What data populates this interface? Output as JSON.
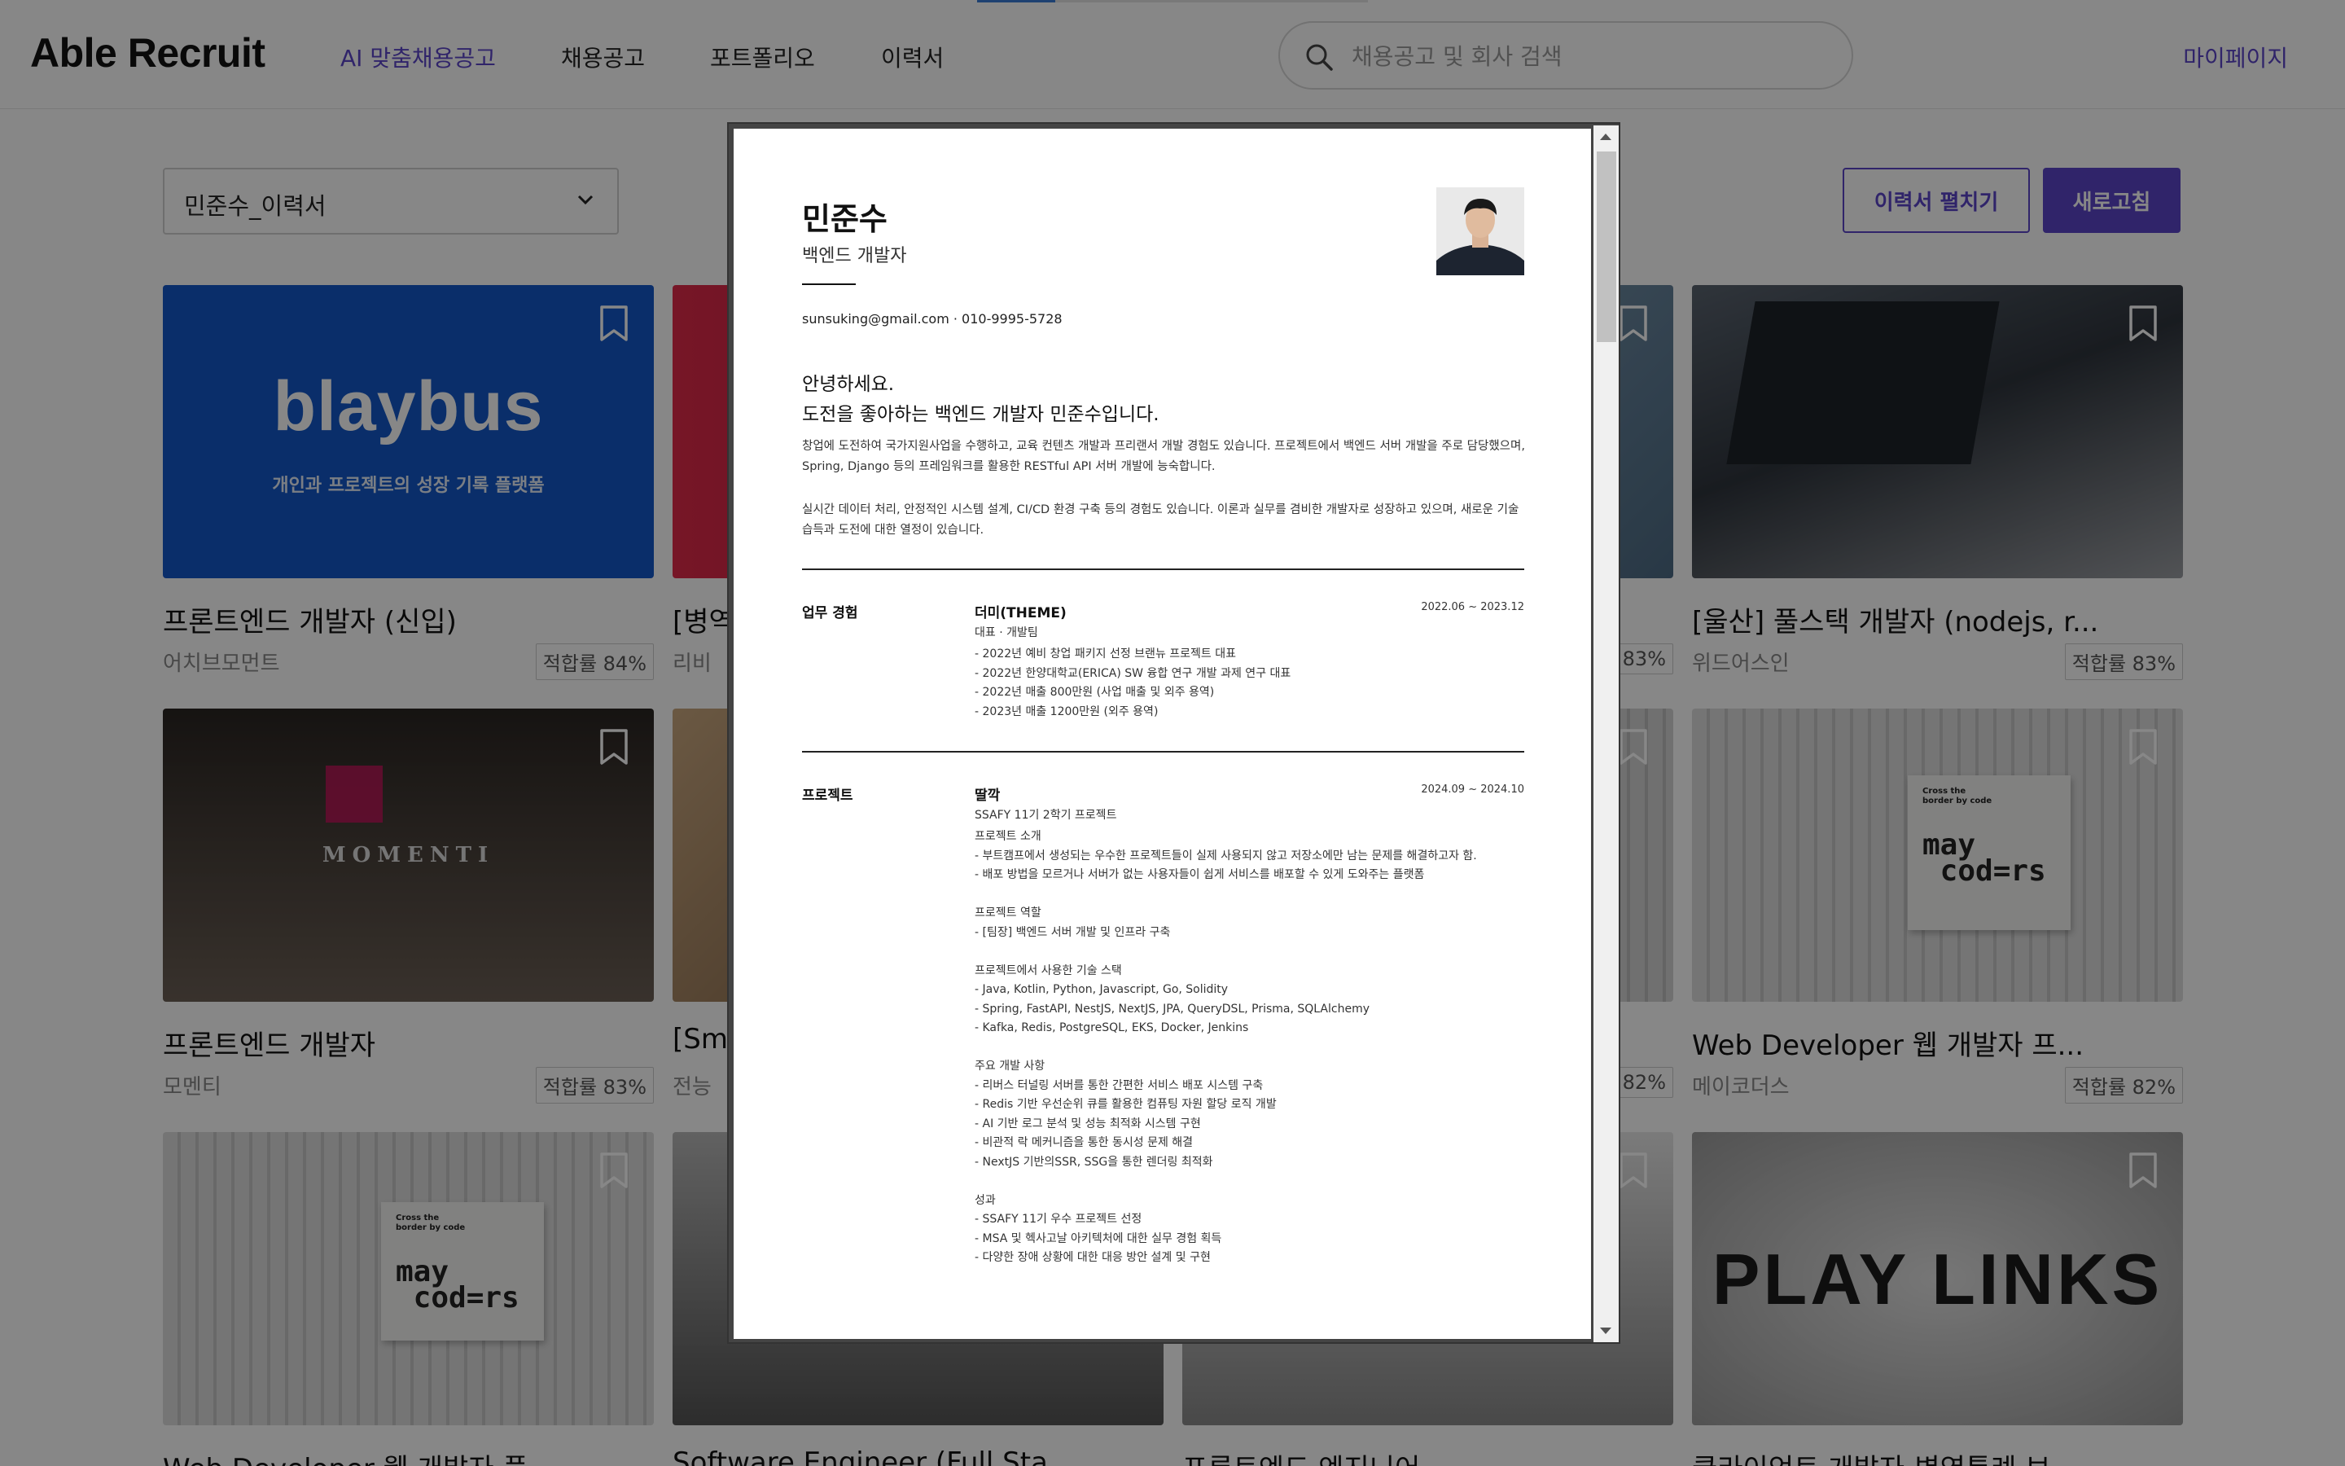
{
  "app": {
    "logo": "Able Recruit"
  },
  "nav": {
    "items": [
      "AI 맞춤채용공고",
      "채용공고",
      "포트폴리오",
      "이력서"
    ],
    "mypage": "마이페이지"
  },
  "search": {
    "placeholder": "채용공고 및 회사 검색"
  },
  "loading_progress": 0.2,
  "toolbar": {
    "resume_select": "민준수_이력서",
    "expand_button": "이력서 펼치기",
    "refresh_button": "새로고침"
  },
  "jobs": [
    {
      "title": "프론트엔드 개발자 (신입)",
      "company": "어치브모먼트",
      "match": "적합률 84%",
      "thumb_text": "blaybus",
      "thumb_sub": "개인과 프로젝트의 성장 기록 플랫폼"
    },
    {
      "title": "[병역",
      "company": "리비",
      "match": "",
      "thumb_text": "",
      "thumb_sub": ""
    },
    {
      "title": "",
      "company": "",
      "match": "83%",
      "thumb_text": "",
      "thumb_sub": ""
    },
    {
      "title": "[울산] 풀스택 개발자 (nodejs, r...",
      "company": "위드어스인",
      "match": "적합률 83%",
      "thumb_text": "",
      "thumb_sub": ""
    },
    {
      "title": "프론트엔드 개발자",
      "company": "모멘티",
      "match": "적합률 83%",
      "thumb_text": "MOMENTI",
      "thumb_sub": ""
    },
    {
      "title": "[Sm",
      "company": "전능",
      "match": "",
      "thumb_text": "",
      "thumb_sub": ""
    },
    {
      "title": "",
      "company": "",
      "match": "82%",
      "thumb_text": "",
      "thumb_sub": ""
    },
    {
      "title": "Web Developer 웹 개발자 프...",
      "company": "메이코더스",
      "match": "적합률 82%",
      "thumb_text": "Cross the border by code maycoders",
      "thumb_sub": ""
    },
    {
      "title": "Web Developer 웹 개발자 풀",
      "company": "",
      "match": "",
      "thumb_text": "Cross the border by code maycoders",
      "thumb_sub": ""
    },
    {
      "title": "Software Engineer (Full Sta",
      "company": "",
      "match": "",
      "thumb_text": "",
      "thumb_sub": ""
    },
    {
      "title": "프론트엔드 엔지니어",
      "company": "",
      "match": "",
      "thumb_text": "",
      "thumb_sub": ""
    },
    {
      "title": "클라이언트 개발자-병역특례 보",
      "company": "",
      "match": "",
      "thumb_text": "PLAY LINKS",
      "thumb_sub": ""
    }
  ],
  "resume": {
    "name": "민준수",
    "role": "백엔드 개발자",
    "contact": "sunsuking@gmail.com · 010-9995-5728",
    "greeting_1": "안녕하세요.",
    "greeting_2": "도전을 좋아하는 백엔드 개발자 민준수입니다.",
    "intro_1a": "창업에 도전하여 국가지원사업을 수행하고, 교육 컨텐츠 개발과 프리랜서 개발 경험도 있습니다. 프로젝트에서 백엔드 서버 개발을 주로 담당했으며,",
    "intro_1b": "Spring, Django 등의 프레임워크를 활용한 RESTful API 서버 개발에 능숙합니다.",
    "intro_2a": "실시간 데이터 처리, 안정적인 시스템 설계, CI/CD 환경 구축 등의 경험도 있습니다. 이론과 실무를 겸비한 개발자로 성장하고 있으며, 새로운 기술",
    "intro_2b": "습득과 도전에 대한 열정이 있습니다.",
    "experience": {
      "section": "업무 경험",
      "company": "더미(THEME)",
      "date": "2022.06 ~ 2023.12",
      "position": "대표 · 개발팀",
      "items": [
        "- 2022년 예비 창업 패키지 선정 브랜뉴 프로젝트 대표",
        "- 2022년 한양대학교(ERICA) SW 융합 연구 개발 과제 연구 대표",
        "- 2022년 매출 800만원 (사업 매출 및 외주 용역)",
        "- 2023년 매출 1200만원 (외주 용역)"
      ]
    },
    "project": {
      "section": "프로젝트",
      "name": "딸깍",
      "date": "2024.09 ~ 2024.10",
      "subtitle": "SSAFY 11기 2학기 프로젝트",
      "lines": [
        "프로젝트 소개",
        "- 부트캠프에서 생성되는 우수한 프로젝트들이 실제 사용되지 않고 저장소에만 남는 문제를 해결하고자 함.",
        "- 배포 방법을 모르거나 서버가 없는 사용자들이 쉽게 서비스를 배포할 수 있게 도와주는 플랫폼",
        "",
        "프로젝트 역할",
        "- [팀장] 백엔드 서버 개발 및 인프라 구축",
        "",
        "프로젝트에서 사용한 기술 스택",
        "- Java, Kotlin, Python, Javascript, Go, Solidity",
        "- Spring, FastAPI, NestJS, NextJS, JPA, QueryDSL, Prisma, SQLAlchemy",
        "- Kafka, Redis, PostgreSQL, EKS, Docker, Jenkins",
        "",
        "주요 개발 사항",
        "- 리버스 터널링 서버를 통한 간편한 서비스 배포 시스템 구축",
        "- Redis 기반 우선순위 큐를 활용한 컴퓨팅 자원 할당 로직 개발",
        "- AI 기반 로그 분석 및 성능 최적화 시스템 구현",
        "- 비관적 락 메커니즘을 통한 동시성 문제 해결",
        "- NextJS 기반의SSR, SSG을 통한 렌더링 최적화",
        "",
        "성과",
        "- SSAFY 11기 우수 프로젝트 선정",
        "- MSA 및 헥사고날 아키텍처에 대한 실무 경험 획득",
        "- 다양한 장애 상황에 대한 대응 방안 설계 및 구현"
      ]
    }
  },
  "icons": {
    "search": "search-icon",
    "bookmark": "bookmark-icon",
    "dropdown": "chevron-down-icon"
  },
  "colors": {
    "accent": "#5b45c8",
    "blaybus_blue": "#1358c8"
  }
}
